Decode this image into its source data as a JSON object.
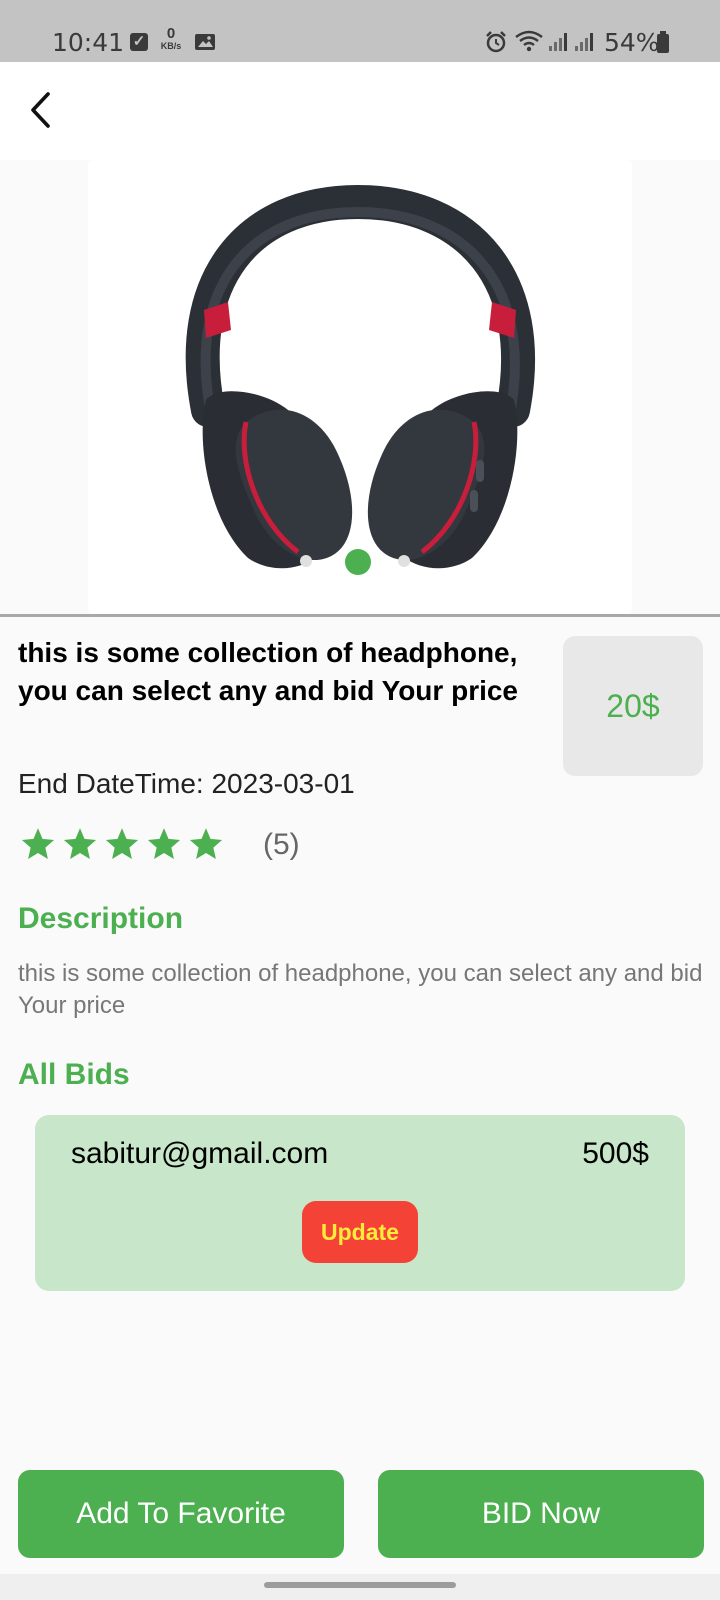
{
  "status_bar": {
    "time": "10:41",
    "net_speed_value": "0",
    "net_speed_unit": "KB/s",
    "battery": "54%",
    "icons": [
      "checkbox-icon",
      "gallery-icon",
      "alarm-icon",
      "wifi-icon",
      "signal-icon",
      "signal-icon",
      "battery-icon"
    ]
  },
  "header": {
    "back_icon": "chevron-left-icon"
  },
  "carousel": {
    "image": "headphones-image",
    "page_count": 3,
    "active_index": 1
  },
  "product": {
    "title": "this is some collection of headphone, you can select any and bid Your price",
    "price": "20$",
    "end_datetime": "End DateTime: 2023-03-01",
    "rating": 5,
    "rating_max": 5,
    "rating_count": "(5)"
  },
  "description": {
    "heading": "Description",
    "text": "this is some collection of headphone, you can select any and bid Your price"
  },
  "bids": {
    "heading": "All Bids",
    "items": [
      {
        "email": "sabitur@gmail.com",
        "amount": "500$",
        "action_label": "Update"
      }
    ]
  },
  "actions": {
    "favorite_label": "Add To Favorite",
    "bid_label": "BID Now"
  },
  "colors": {
    "accent": "#4caf50",
    "bid_card": "#c8e6c9",
    "update_button": "#f44336",
    "update_text": "#ffeb3b",
    "price_box": "#e8e8e8"
  }
}
